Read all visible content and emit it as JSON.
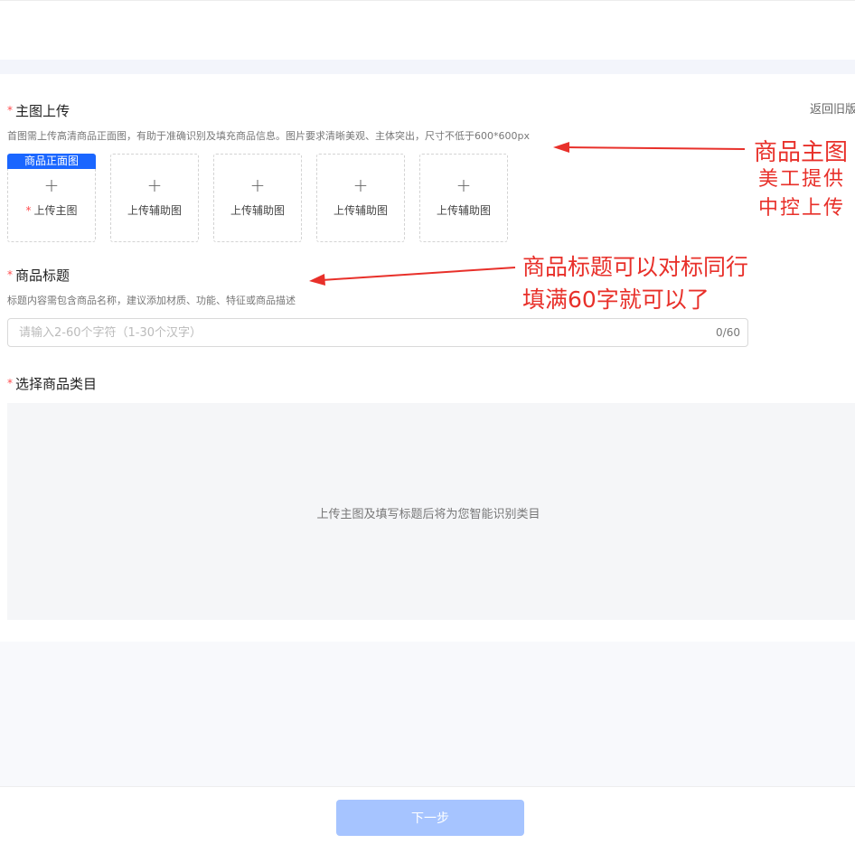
{
  "header": {
    "return_link": "返回旧版"
  },
  "main_image": {
    "title": "主图上传",
    "required_mark": "*",
    "desc": "首图需上传高清商品正面图，有助于准确识别及填充商品信息。图片要求清晰美观、主体突出，尺寸不低于600*600px",
    "slots": [
      {
        "tag": "商品正面图",
        "label": "上传主图",
        "required": "*"
      },
      {
        "label": "上传辅助图"
      },
      {
        "label": "上传辅助图"
      },
      {
        "label": "上传辅助图"
      },
      {
        "label": "上传辅助图"
      }
    ],
    "plus_symbol": "+"
  },
  "product_title": {
    "title": "商品标题",
    "required_mark": "*",
    "desc": "标题内容需包含商品名称，建议添加材质、功能、特征或商品描述",
    "input_placeholder": "请输入2-60个字符（1-30个汉字）",
    "input_value": "",
    "count": "0/60"
  },
  "category": {
    "title": "选择商品类目",
    "required_mark": "*",
    "hint": "上传主图及填写标题后将为您智能识别类目"
  },
  "footer": {
    "next_label": "下一步"
  },
  "annotations": {
    "main_image_note": [
      "商品主图",
      "美工提供",
      "中控上传"
    ],
    "title_note": [
      "商品标题可以对标同行",
      "填满60字就可以了"
    ],
    "color": "#e8302a"
  }
}
